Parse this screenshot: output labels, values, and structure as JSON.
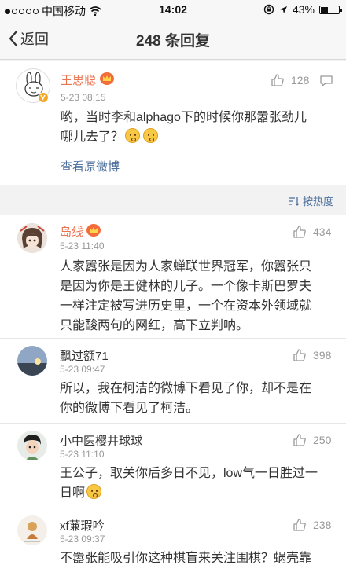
{
  "status_bar": {
    "carrier": "中国移动",
    "time": "14:02",
    "battery": "43%",
    "battery_level": 0.43
  },
  "nav": {
    "back_label": "返回",
    "title": "248 条回复"
  },
  "original": {
    "author": "王思聪",
    "time": "5-23 08:15",
    "likes": "128",
    "text_line1": "哟，当时李和alphago下的时候你那嚣张劲儿",
    "text_line2": "哪儿去了？",
    "view_original": "查看原微博"
  },
  "sort": {
    "label": "按热度"
  },
  "replies": [
    {
      "author": "岛线",
      "time": "5-23 11:40",
      "likes": "434",
      "lines": [
        "人家嚣张是因为人家蝉联世界冠军，你嚣张只",
        "是因为你是王健林的儿子。一个像卡斯巴罗夫",
        "一样注定被写进历史里，一个在资本外领域就",
        "只能酸两句的网红，高下立判呐。"
      ]
    },
    {
      "author": "飘过额71",
      "time": "5-23 09:47",
      "likes": "398",
      "lines": [
        "所以，我在柯洁的微博下看见了你，却不是在",
        "你的微博下看见了柯洁。"
      ]
    },
    {
      "author": "小中医樱井球球",
      "time": "5-23 11:10",
      "likes": "250",
      "lines": [
        "王公子，取关你后多日不见，low气一日胜过一",
        "日啊"
      ]
    },
    {
      "author": "xf蒹瑕吟",
      "time": "5-23 09:37",
      "likes": "238",
      "lines": [
        "不嚣张能吸引你这种棋盲来关注围棋？蜗壳靠"
      ]
    }
  ]
}
